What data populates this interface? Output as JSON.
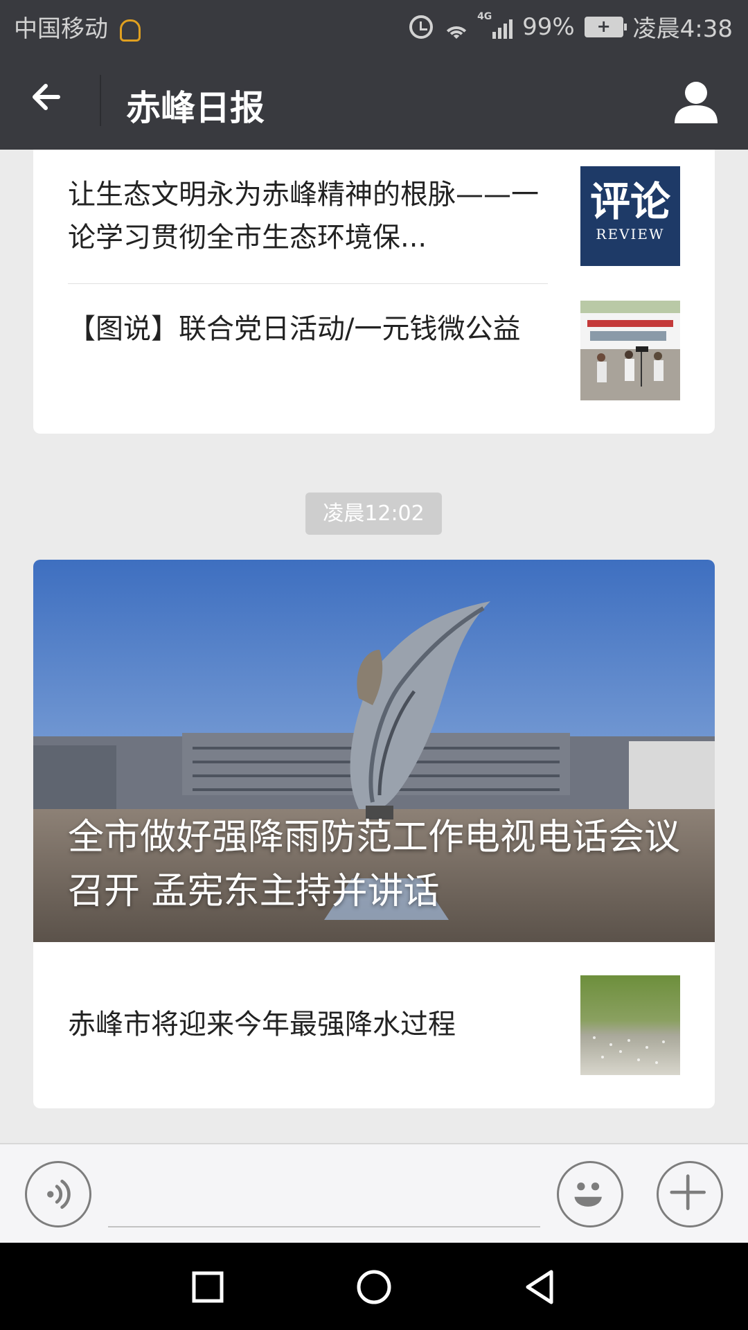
{
  "status_bar": {
    "carrier": "中国移动",
    "network": "4G",
    "battery": "99%",
    "time": "凌晨4:38",
    "icons": [
      "chat-bubble-icon",
      "alarm-icon",
      "wifi-icon",
      "signal-icon",
      "battery-icon"
    ]
  },
  "header": {
    "title": "赤峰日报",
    "icons": [
      "back-arrow-icon",
      "profile-icon"
    ]
  },
  "feed": {
    "card1": {
      "articles": [
        {
          "title": "让生态文明永为赤峰精神的根脉——一论学习贯彻全市生态环境保...",
          "thumb": "review-thumbnail"
        },
        {
          "title": "【图说】联合党日活动/一元钱微公益",
          "thumb": "photo-thumbnail"
        }
      ],
      "review_thumb": {
        "big": "评论",
        "small": "REVIEW"
      }
    },
    "timestamp": "凌晨12:02",
    "card2": {
      "hero_title": "全市做好强降雨防范工作电视电话会议召开 孟宪东主持并讲话",
      "articles": [
        {
          "title": "赤峰市将迎来今年最强降水过程",
          "thumb": "rain-thumbnail"
        }
      ]
    }
  },
  "input_bar": {
    "icons": [
      "voice-icon",
      "emoji-icon",
      "plus-icon"
    ]
  },
  "nav_bar": {
    "icons": [
      "recent-apps-icon",
      "home-icon",
      "back-icon"
    ]
  },
  "colors": {
    "header_bg": "#393a3f",
    "page_bg": "#ebebeb",
    "review_bg": "#1e3a67"
  }
}
